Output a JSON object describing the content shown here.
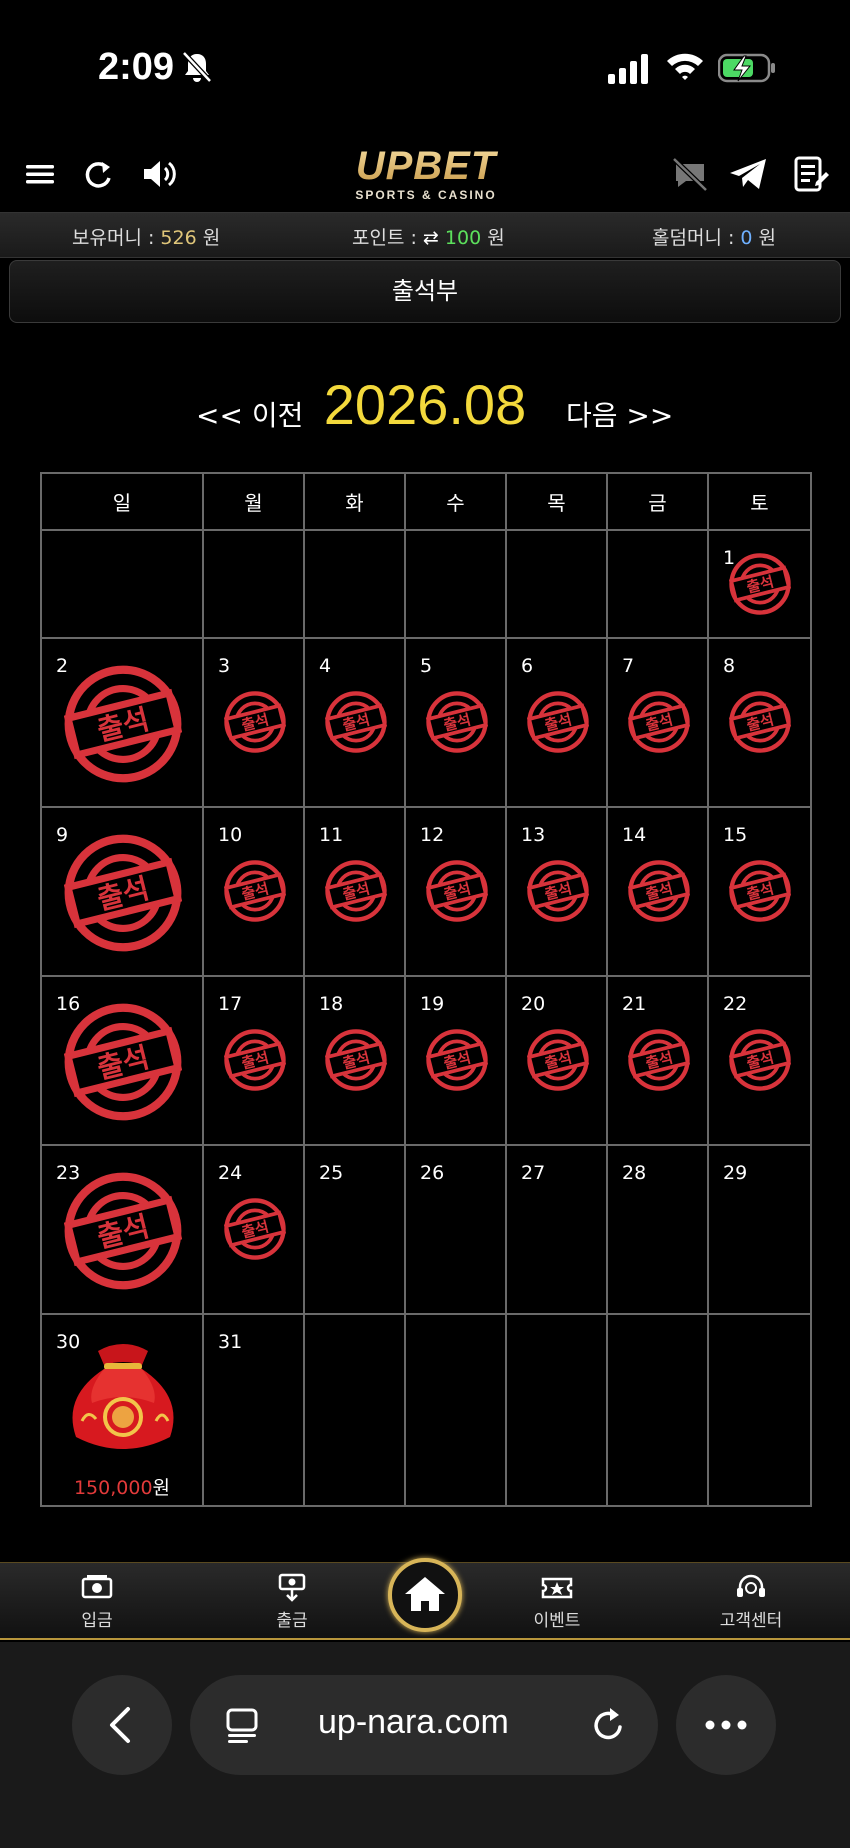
{
  "status_bar": {
    "time": "2:09"
  },
  "header": {
    "logo_main": "UPBET",
    "logo_sub": "SPORTS & CASINO"
  },
  "balance": {
    "holding_label": "보유머니 : ",
    "holding_value": "526",
    "holding_unit": " 원",
    "point_label": "포인트 : ",
    "point_value": "100",
    "point_unit": " 원",
    "holdem_label": "홀덤머니 : ",
    "holdem_value": "0",
    "holdem_unit": " 원"
  },
  "page_title": "출석부",
  "calendar": {
    "prev_label": "<< 이전",
    "month": "2026.08",
    "next_label": "다음 >>",
    "weekdays": [
      "일",
      "월",
      "화",
      "수",
      "목",
      "금",
      "토"
    ],
    "stamp_text": "출석",
    "reward_amount": "150,000",
    "reward_unit": "원",
    "stamp_color": "#d8333b"
  },
  "bottom_nav": {
    "deposit": "입금",
    "withdraw": "출금",
    "event": "이벤트",
    "support": "고객센터"
  },
  "browser": {
    "url": "up-nara.com"
  }
}
